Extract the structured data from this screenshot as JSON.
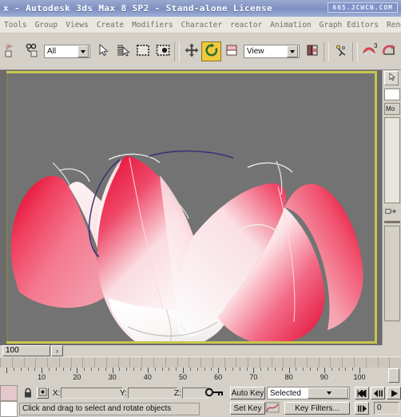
{
  "window": {
    "title": "x  -  Autodesk 3ds Max 8 SP2  -  Stand-alone License",
    "watermark": "665.JCWCN.COM"
  },
  "menu": {
    "items": [
      {
        "label": "Tools"
      },
      {
        "label": "Group"
      },
      {
        "label": "Views"
      },
      {
        "label": "Create"
      },
      {
        "label": "Modifiers"
      },
      {
        "label": "Character"
      },
      {
        "label": "reactor"
      },
      {
        "label": "Animation"
      },
      {
        "label": "Graph Editors"
      },
      {
        "label": "Renderi"
      }
    ]
  },
  "toolbar": {
    "selection_filter_value": "All",
    "coord_system_value": "View",
    "buttons": [
      {
        "name": "select-and-link",
        "icon": "link-icon"
      },
      {
        "name": "unlink-selection",
        "icon": "unlink-icon"
      },
      {
        "name": "select-object",
        "icon": "arrow-cursor-icon"
      },
      {
        "name": "select-by-name",
        "icon": "select-by-name-icon"
      },
      {
        "name": "rectangular-selection-region",
        "icon": "marquee-rect-icon"
      },
      {
        "name": "window-crossing",
        "icon": "window-crossing-icon"
      },
      {
        "name": "select-and-move",
        "icon": "move-arrows-icon"
      },
      {
        "name": "select-and-rotate",
        "icon": "rotate-arrow-icon",
        "active": true
      },
      {
        "name": "select-and-scale",
        "icon": "scale-icon"
      },
      {
        "name": "use-pivot-point-center",
        "icon": "pivot-center-icon"
      },
      {
        "name": "mirror",
        "icon": "mirror-icon"
      },
      {
        "name": "align",
        "icon": "align-icon"
      },
      {
        "name": "manipulate",
        "icon": "manipulate-icon"
      },
      {
        "name": "snap-toggle",
        "icon": "snap-magnet-3-icon"
      },
      {
        "name": "angle-snap-toggle",
        "icon": "angle-snap-icon"
      }
    ]
  },
  "command_panel": {
    "modifier_list_label": "Mo"
  },
  "viewport": {
    "label": "",
    "scene_object": "lotus-flower",
    "background_color": "#737373",
    "active_border_color": "#c8c64f",
    "petal_colors": {
      "deep": "#e8294a",
      "mid": "#f06a86",
      "light": "#fbe2e6",
      "white": "#ffffff"
    }
  },
  "timeline": {
    "frame_field_value": "100",
    "frame_arrow": "›",
    "ruler_labels": [
      "10",
      "20",
      "30",
      "40",
      "50",
      "60",
      "70",
      "80",
      "90",
      "100"
    ],
    "ruler_values": [
      10,
      20,
      30,
      40,
      50,
      60,
      70,
      80,
      90,
      100
    ]
  },
  "status_bar": {
    "lock_icon": "lock-icon",
    "selection_icon": "selection-lock-icon",
    "coords": [
      {
        "label": "X:",
        "value": ""
      },
      {
        "label": "Y:",
        "value": ""
      },
      {
        "label": "Z:",
        "value": ""
      }
    ],
    "key_icon": "key-icon",
    "prompt": "Click and drag to select and rotate objects"
  },
  "animation_bar": {
    "auto_key_label": "Auto Key",
    "set_key_label": "Set Key",
    "selected_value": "Selected",
    "key_filters_label": "Key Filters...",
    "curve_icon": "function-curve-icon",
    "nav": [
      {
        "name": "go-to-start-button",
        "glyph": "⏮"
      },
      {
        "name": "previous-frame-button",
        "glyph": "◂II"
      },
      {
        "name": "play-animation-button",
        "glyph": "▶"
      },
      {
        "name": "next-frame-button",
        "glyph": "II▸"
      }
    ],
    "current_frame": "0"
  }
}
